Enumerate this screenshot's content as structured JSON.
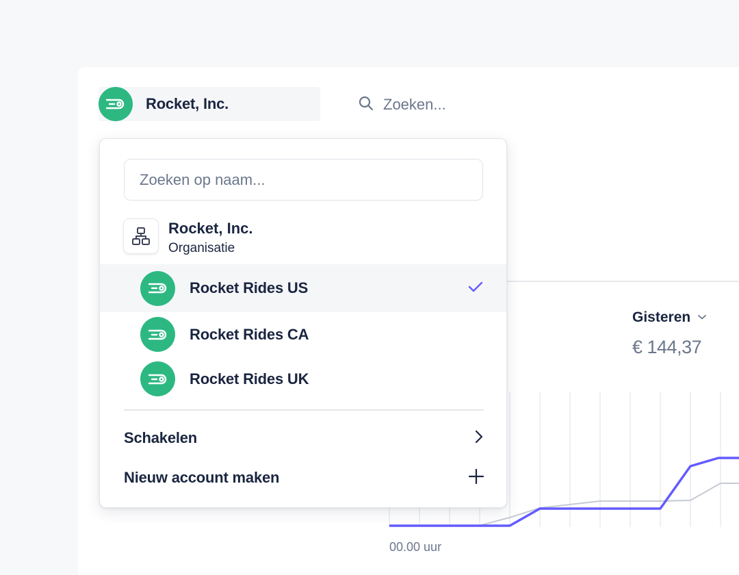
{
  "header": {
    "account_name": "Rocket, Inc.",
    "search_placeholder": "Zoeken..."
  },
  "dropdown": {
    "search_placeholder": "Zoeken op naam...",
    "organization": {
      "name": "Rocket, Inc.",
      "type": "Organisatie",
      "icon": "org-chart-icon"
    },
    "accounts": [
      {
        "label": "Rocket Rides US",
        "selected": true
      },
      {
        "label": "Rocket Rides CA",
        "selected": false
      },
      {
        "label": "Rocket Rides UK",
        "selected": false
      }
    ],
    "actions": {
      "switch_label": "Schakelen",
      "new_account_label": "Nieuw account maken"
    }
  },
  "summary": {
    "period_label": "Gisteren",
    "period_value": "€ 144,37"
  },
  "chart": {
    "x_start_label": "00.00 uur"
  },
  "colors": {
    "brand_green": "#2db882",
    "accent_purple": "#635bff",
    "text_dark": "#1a2540",
    "text_muted": "#6b778c"
  }
}
